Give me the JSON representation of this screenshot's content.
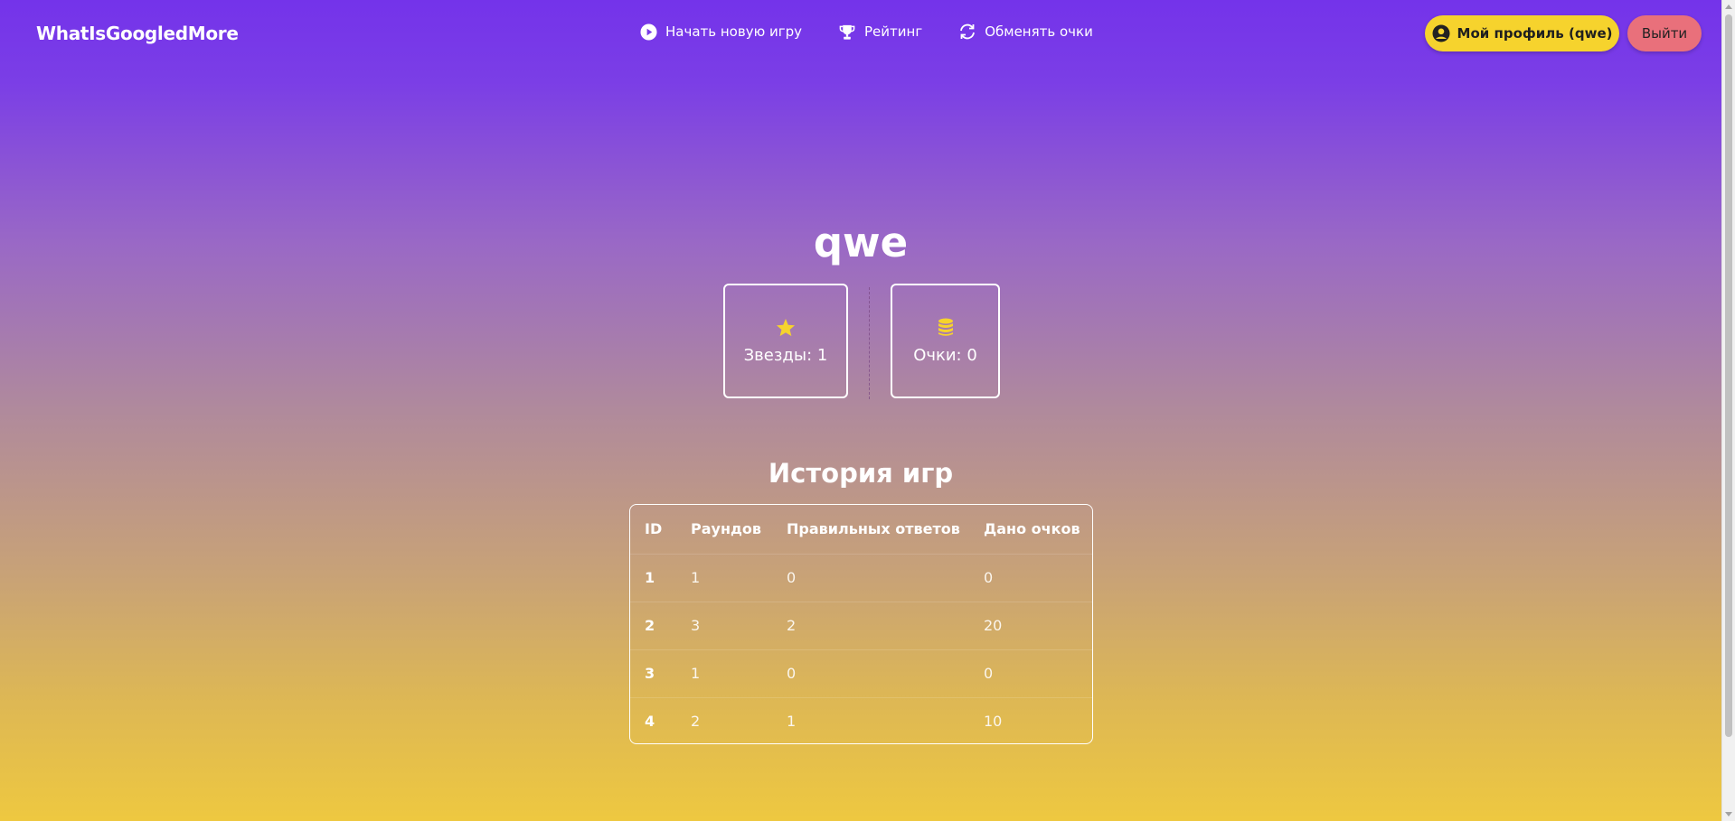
{
  "navbar": {
    "brand": "WhatIsGoogledMore",
    "links": [
      {
        "label": "Начать новую игру",
        "icon": "play-circle-icon"
      },
      {
        "label": "Рейтинг",
        "icon": "trophy-icon"
      },
      {
        "label": "Обменять очки",
        "icon": "refresh-icon"
      }
    ],
    "profile_button": "Мой профиль (qwe)",
    "logout_button": "Выйти"
  },
  "profile": {
    "username": "qwe",
    "stars_label": "Звезды: 1",
    "points_label": "Очки: 0"
  },
  "history": {
    "title": "История игр",
    "columns": [
      "ID",
      "Раундов",
      "Правильных ответов",
      "Дано очков"
    ],
    "rows": [
      [
        "1",
        "1",
        "0",
        "0"
      ],
      [
        "2",
        "3",
        "2",
        "20"
      ],
      [
        "3",
        "1",
        "0",
        "0"
      ],
      [
        "4",
        "2",
        "1",
        "10"
      ]
    ]
  },
  "colors": {
    "accent_yellow": "#f6d32d",
    "logout_red": "#e9707b",
    "gradient_top": "#7433ea",
    "gradient_bottom": "#eec840"
  }
}
